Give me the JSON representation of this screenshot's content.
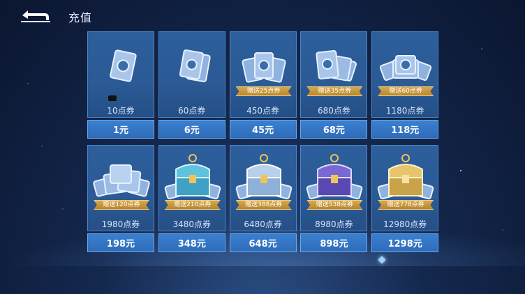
{
  "header": {
    "title": "充值"
  },
  "cards": [
    {
      "amount": "10点券",
      "price": "1元",
      "ribbon": "",
      "icon": "coupon-card-icon"
    },
    {
      "amount": "60点券",
      "price": "6元",
      "ribbon": "",
      "icon": "coupon-cards-icon"
    },
    {
      "amount": "450点券",
      "price": "45元",
      "ribbon": "赠送25点券",
      "icon": "coupon-stack-icon"
    },
    {
      "amount": "680点券",
      "price": "68元",
      "ribbon": "赠送35点券",
      "icon": "coupon-stack-icon"
    },
    {
      "amount": "1180点券",
      "price": "118元",
      "ribbon": "赠送60点券",
      "icon": "coupon-pile-icon"
    },
    {
      "amount": "1980点券",
      "price": "198元",
      "ribbon": "赠送120点券",
      "icon": "coupon-pile-icon"
    },
    {
      "amount": "3480点券",
      "price": "348元",
      "ribbon": "赠送210点券",
      "icon": "treasure-chest-teal-icon"
    },
    {
      "amount": "6480点券",
      "price": "648元",
      "ribbon": "赠送388点券",
      "icon": "treasure-chest-silver-icon"
    },
    {
      "amount": "8980点券",
      "price": "898元",
      "ribbon": "赠送538点券",
      "icon": "treasure-chest-purple-icon"
    },
    {
      "amount": "12980点券",
      "price": "1298元",
      "ribbon": "赠送778点券",
      "icon": "treasure-chest-gold-icon"
    }
  ],
  "colors": {
    "card": "#2d5f9c",
    "price_bar": "#3a80d0",
    "ribbon": "#d7a94f"
  }
}
